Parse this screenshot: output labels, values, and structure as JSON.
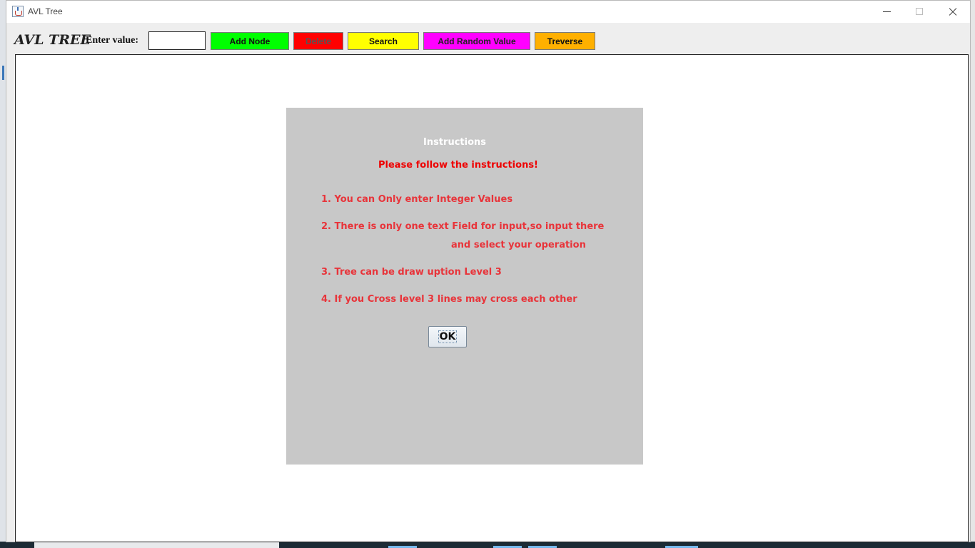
{
  "window": {
    "title": "AVL Tree",
    "icon": "java-app-icon"
  },
  "toolbar": {
    "app_title": "AVL TREE",
    "enter_label": "Enter value:",
    "value_input": "",
    "buttons": {
      "add_node": "Add Node",
      "delete": "Delete",
      "search": "Search",
      "add_random": "Add Random Value",
      "traverse": "Treverse"
    },
    "colors": {
      "add_node": "#00ff00",
      "delete": "#ff0000",
      "search": "#ffff00",
      "add_random": "#ff00ff",
      "traverse": "#ffb000"
    }
  },
  "dialog": {
    "title": "Instructions",
    "subtitle": "Please follow the instructions!",
    "lines": [
      "1. You can Only enter Integer Values",
      "2. There is only one text Field for input,so input there",
      "and select your operation",
      "3. Tree can be draw uption Level 3",
      "4. If you Cross level 3 lines may cross each other"
    ],
    "ok_label": "OK",
    "background": "#c8c8c8",
    "text_color": "#e8343a"
  }
}
